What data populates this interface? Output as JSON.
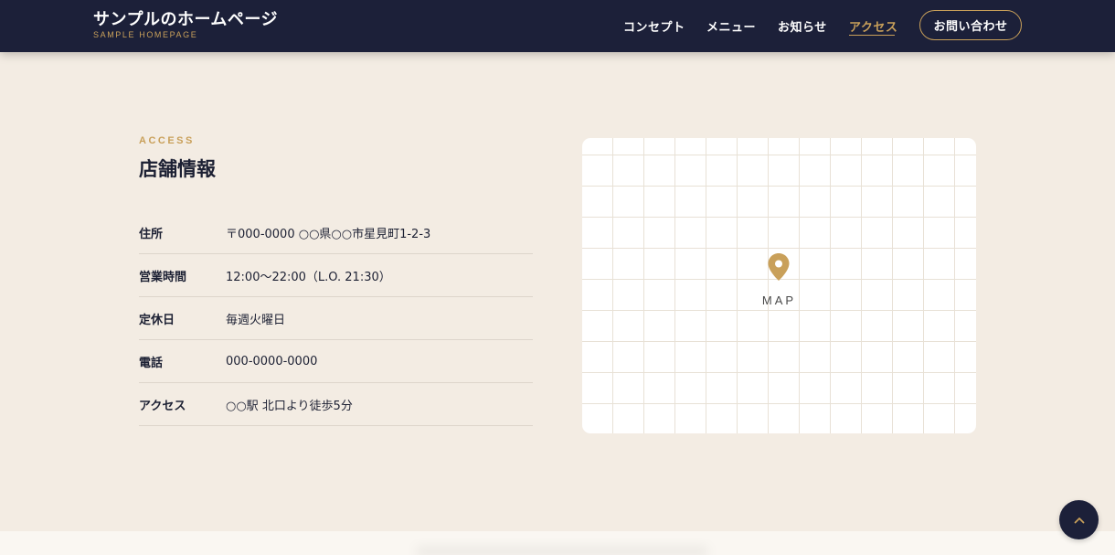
{
  "header": {
    "brand_title": "サンプルのホームページ",
    "brand_subtitle": "SAMPLE HOMEPAGE",
    "nav": [
      {
        "label": "コンセプト"
      },
      {
        "label": "メニュー"
      },
      {
        "label": "お知らせ"
      },
      {
        "label": "アクセス",
        "active": true
      }
    ],
    "contact_label": "お問い合わせ"
  },
  "access": {
    "eyebrow": "ACCESS",
    "title": "店舗情報",
    "rows": [
      {
        "label": "住所",
        "value": "〒000-0000 ○○県○○市星見町1-2-3"
      },
      {
        "label": "営業時間",
        "value": "12:00〜22:00（L.O. 21:30）"
      },
      {
        "label": "定休日",
        "value": "毎週火曜日"
      },
      {
        "label": "電話",
        "value": "000-0000-0000"
      },
      {
        "label": "アクセス",
        "value": "○○駅 北口より徒歩5分"
      }
    ]
  },
  "map": {
    "label": "MAP",
    "icon": "map-pin-icon"
  },
  "back_to_top": {
    "icon": "chevron-up-icon"
  },
  "colors": {
    "navy": "#1c2039",
    "gold": "#c9a05a",
    "background": "#f3ece3"
  }
}
